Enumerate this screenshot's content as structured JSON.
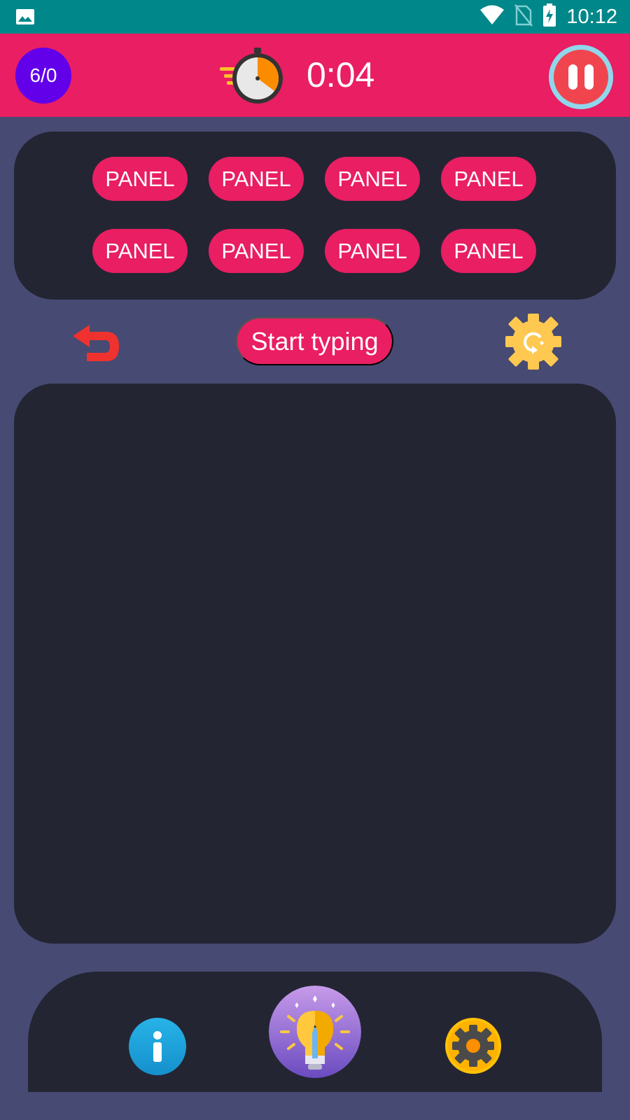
{
  "status_bar": {
    "time": "10:12",
    "icons": [
      "image-icon",
      "wifi-icon",
      "no-sim-icon",
      "battery-charging-icon"
    ]
  },
  "header": {
    "score": "6/0",
    "timer": "0:04",
    "icons": [
      "stopwatch-icon",
      "pause-icon"
    ]
  },
  "panels": {
    "items": [
      "PANEL",
      "PANEL",
      "PANEL",
      "PANEL",
      "PANEL",
      "PANEL",
      "PANEL",
      "PANEL"
    ]
  },
  "controls": {
    "start_label": "Start typing",
    "icons": [
      "undo-icon",
      "reset-gear-icon"
    ]
  },
  "bottom_nav": {
    "icons": [
      "info-icon",
      "idea-lightbulb-icon",
      "settings-gear-icon"
    ]
  },
  "colors": {
    "background": "#474A72",
    "status_bar": "#00878A",
    "accent": "#E91E63",
    "card": "#242533",
    "score_badge": "#6200EA"
  }
}
